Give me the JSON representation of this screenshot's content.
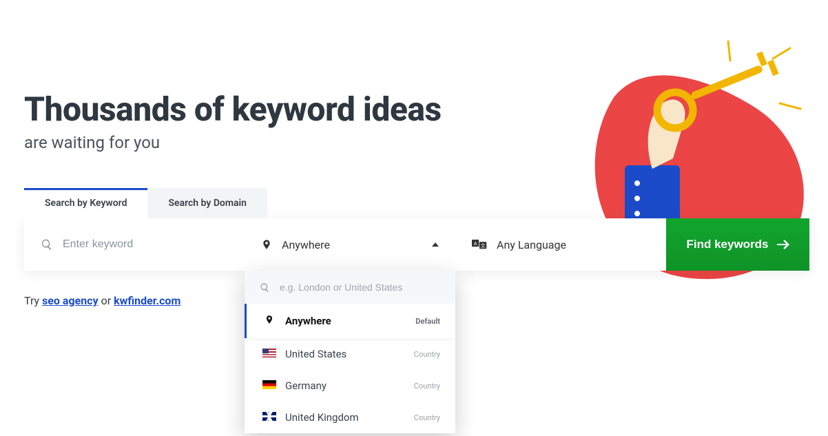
{
  "heading": {
    "title": "Thousands of keyword ideas",
    "subtitle": "are waiting for you"
  },
  "tabs": [
    {
      "label": "Search by Keyword",
      "active": true
    },
    {
      "label": "Search by Domain",
      "active": false
    }
  ],
  "search": {
    "keyword_placeholder": "Enter keyword",
    "location_selected": "Anywhere",
    "language_selected": "Any Language",
    "button_label": "Find keywords"
  },
  "location_dropdown": {
    "search_placeholder": "e.g. London or United States",
    "items": [
      {
        "name": "Anywhere",
        "tag": "Default",
        "flag": null,
        "selected": true
      },
      {
        "name": "United States",
        "tag": "Country",
        "flag": "us",
        "selected": false
      },
      {
        "name": "Germany",
        "tag": "Country",
        "flag": "de",
        "selected": false
      },
      {
        "name": "United Kingdom",
        "tag": "Country",
        "flag": "uk",
        "selected": false
      }
    ]
  },
  "try": {
    "prefix": "Try ",
    "link1": "seo agency",
    "mid": " or ",
    "link2": "kwfinder.com"
  },
  "colors": {
    "primary_blue": "#1b4bc9",
    "cta_green": "#0f9327",
    "accent_red": "#eb4545",
    "accent_gold": "#f2b600"
  }
}
